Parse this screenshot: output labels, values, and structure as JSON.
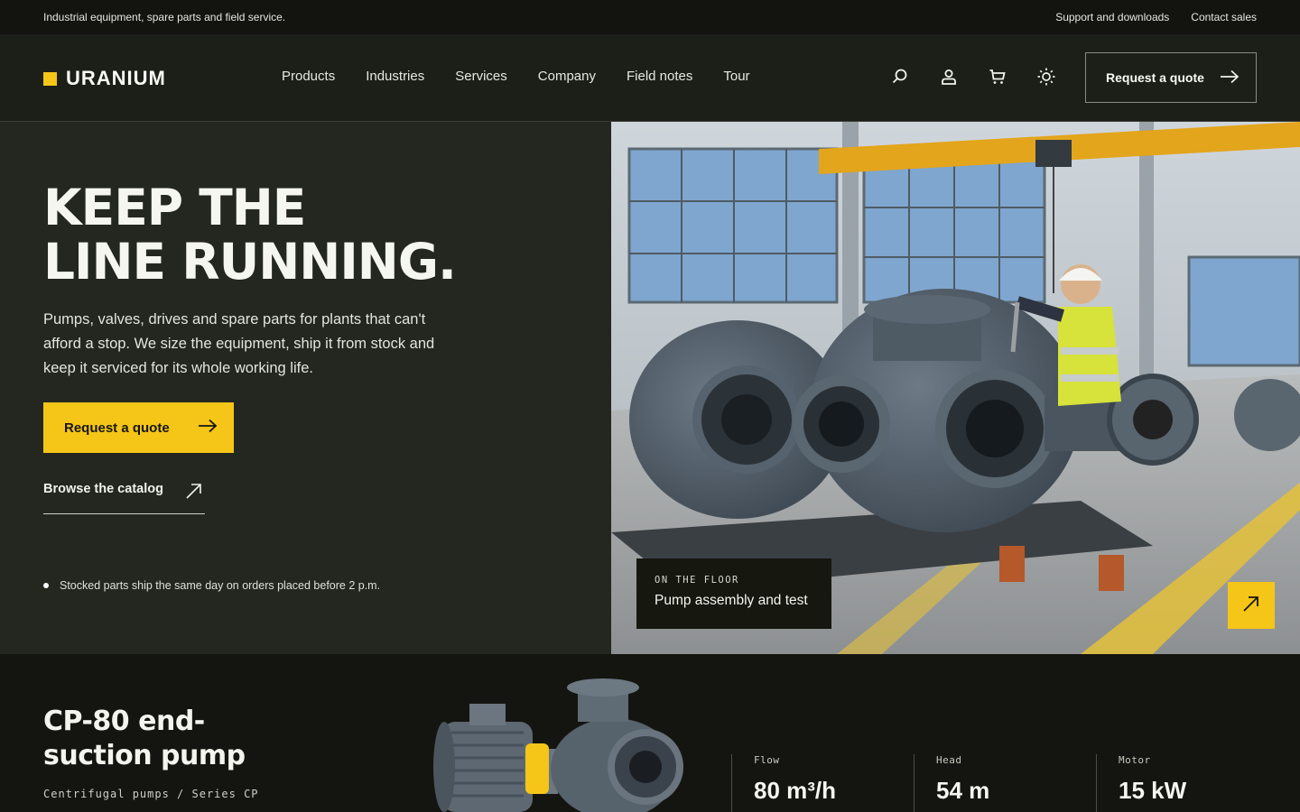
{
  "topbar": {
    "tagline": "Industrial equipment, spare parts and field service.",
    "links": [
      "Support and downloads",
      "Contact sales"
    ]
  },
  "header": {
    "brand": "URANIUM",
    "nav": [
      "Products",
      "Industries",
      "Services",
      "Company",
      "Field notes",
      "Tour"
    ],
    "icons": [
      "search-icon",
      "account-icon",
      "cart-icon",
      "theme-toggle-icon"
    ],
    "quote_label": "Request a quote"
  },
  "hero": {
    "title_line1": "KEEP THE",
    "title_line2": "LINE RUNNING.",
    "description": "Pumps, valves, drives and spare parts for plants that can't afford a stop. We size the equipment, ship it from stock and keep it serviced for its whole working life.",
    "cta_label": "Request a quote",
    "browse_label": "Browse the catalog",
    "note": "Stocked parts ship the same day on orders placed before 2 p.m.",
    "caption_kicker": "ON THE FLOOR",
    "caption_title": "Pump assembly and test"
  },
  "product": {
    "title_line1": "CP-80 end-",
    "title_line2": "suction pump",
    "category": "Centrifugal pumps / Series CP",
    "specs": [
      {
        "label": "Flow",
        "value": "80 m³/h"
      },
      {
        "label": "Head",
        "value": "54 m"
      },
      {
        "label": "Motor",
        "value": "15 kW"
      }
    ]
  },
  "colors": {
    "accent": "#f5c518",
    "dark": "#131410",
    "hero_panel": "#23271f"
  }
}
